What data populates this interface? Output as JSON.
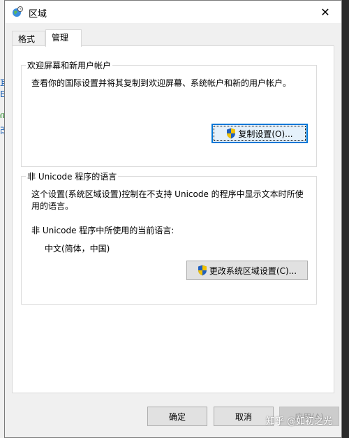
{
  "window": {
    "title": "区域",
    "close_symbol": "✕"
  },
  "tabs": [
    {
      "label": "格式",
      "active": false
    },
    {
      "label": "管理",
      "active": true
    }
  ],
  "welcome_group": {
    "title": "欢迎屏幕和新用户帐户",
    "description": "查看你的国际设置并将其复制到欢迎屏幕、系统帐户和新的用户帐户。",
    "copy_button": "复制设置(O)..."
  },
  "unicode_group": {
    "title": "非 Unicode 程序的语言",
    "description_line1": "这个设置(系统区域设置)控制在不支持 Unicode 的程序中显示文本时所使",
    "description_line2": "用的语言。",
    "current_label": "非 Unicode 程序中所使用的当前语言:",
    "current_value": "中文(简体，中国)",
    "change_button": "更改系统区域设置(C)..."
  },
  "footer": {
    "ok": "确定",
    "cancel": "取消",
    "apply": "应用(A)"
  },
  "watermark": "知乎 @如初之光",
  "background_fragments": [
    "耳",
    "E",
    "ቢ",
    "改"
  ],
  "colors": {
    "accent": "#0078d7",
    "shield_blue": "#1f5fbf",
    "shield_yellow": "#f2c200"
  }
}
